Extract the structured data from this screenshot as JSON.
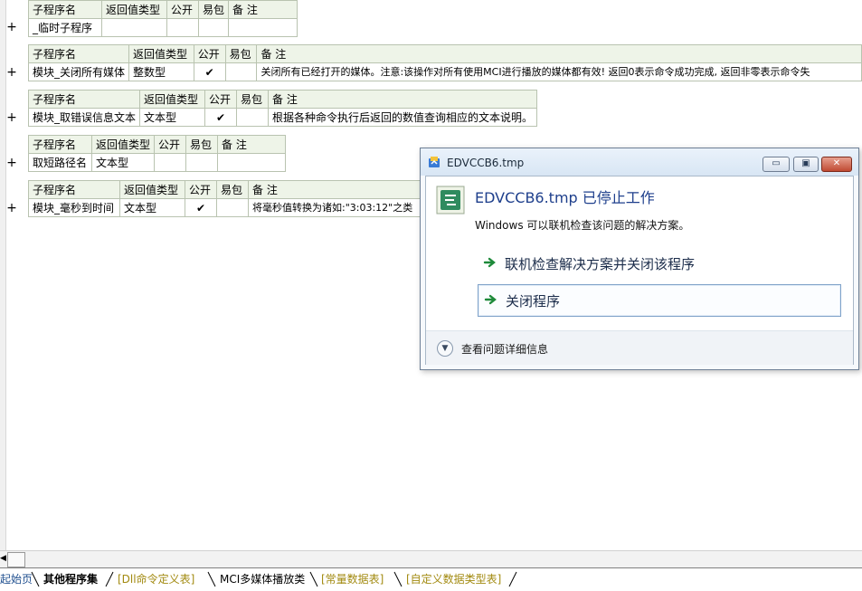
{
  "headers": {
    "name": "子程序名",
    "return_type": "返回值类型",
    "public": "公开",
    "easy_pack": "易包",
    "note": "备 注"
  },
  "subroutines": [
    {
      "name": "_临时子程序",
      "return_type": "",
      "public": "",
      "easy_pack": "",
      "note": ""
    },
    {
      "name": "模块_关闭所有媒体",
      "return_type": "整数型",
      "public": "✔",
      "easy_pack": "",
      "note": "关闭所有已经打开的媒体。注意:该操作对所有使用MCI进行播放的媒体都有效! 返回0表示命令成功完成, 返回非零表示命令失"
    },
    {
      "name": "模块_取错误信息文本",
      "return_type": "文本型",
      "public": "✔",
      "easy_pack": "",
      "note": "根据各种命令执行后返回的数值查询相应的文本说明。"
    },
    {
      "name": "取短路径名",
      "return_type": "文本型",
      "public": "",
      "easy_pack": "",
      "note": ""
    },
    {
      "name": "模块_毫秒到时间",
      "return_type": "文本型",
      "public": "✔",
      "easy_pack": "",
      "note": "将毫秒值转换为诸如:\"3:03:12\"之类"
    }
  ],
  "expand_symbol": "+",
  "dialog": {
    "window_title": "EDVCCB6.tmp",
    "heading": "EDVCCB6.tmp 已停止工作",
    "message": "Windows 可以联机检查该问题的解决方案。",
    "option_check_online": "联机检查解决方案并关闭该程序",
    "option_close": "关闭程序",
    "details": "查看问题详细信息",
    "btn_min": "▭",
    "btn_max": "▣",
    "btn_close": "✕"
  },
  "tabs": [
    {
      "label": "起始页"
    },
    {
      "label": "其他程序集"
    },
    {
      "label": "[Dll命令定义表]"
    },
    {
      "label": "MCI多媒体播放类"
    },
    {
      "label": "[常量数据表]"
    },
    {
      "label": "[自定义数据类型表]"
    }
  ],
  "colors": {
    "header_bg": "#eef4e8",
    "grid_border": "#b9c3b0",
    "type_text": "#00008b",
    "note_text": "#008000",
    "check": "#8b0000",
    "dialog_heading": "#1e3f8c",
    "tab_olive": "#a28a10"
  },
  "icons": {
    "app": "edvccb-app-icon",
    "program": "easy-language-icon",
    "arrow": "green-arrow-icon",
    "expand": "chevron-down-icon"
  }
}
